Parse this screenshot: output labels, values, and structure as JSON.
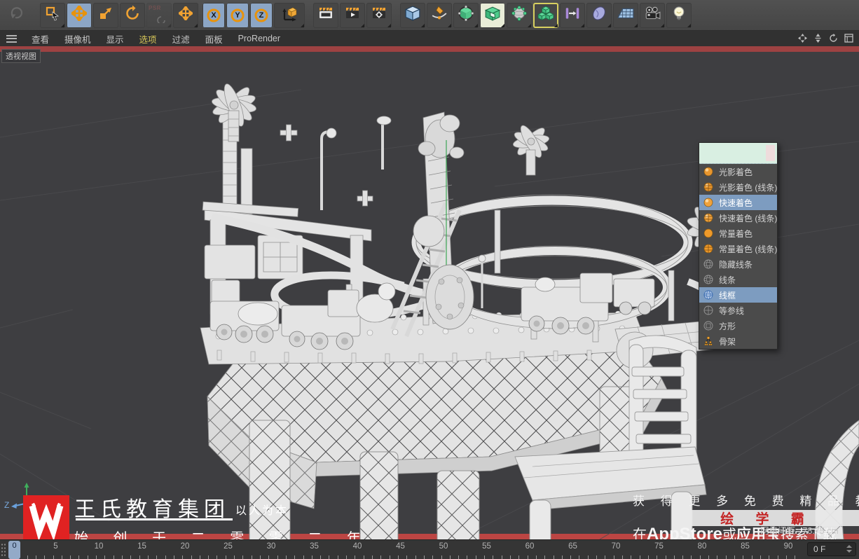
{
  "menubar": {
    "items": [
      {
        "label": "查看",
        "active": false
      },
      {
        "label": "摄像机",
        "active": false
      },
      {
        "label": "显示",
        "active": false
      },
      {
        "label": "选项",
        "active": true
      },
      {
        "label": "过滤",
        "active": false
      },
      {
        "label": "面板",
        "active": false
      },
      {
        "label": "ProRender",
        "active": false
      }
    ]
  },
  "toolbar": {
    "psr_label": "PSR",
    "axis": [
      "X",
      "Y",
      "Z"
    ]
  },
  "viewport": {
    "label": "透视视图",
    "grid_spacing": "网格间距 : 78.75 cm",
    "axis_z_label": "Z"
  },
  "shading_menu": {
    "items": [
      {
        "label": "光影着色",
        "selected": false
      },
      {
        "label": "光影着色 (线条)",
        "selected": false
      },
      {
        "label": "快速着色",
        "selected": true
      },
      {
        "label": "快速着色 (线条)",
        "selected": false
      },
      {
        "label": "常量着色",
        "selected": false
      },
      {
        "label": "常量着色 (线条)",
        "selected": false
      },
      {
        "label": "隐藏线条",
        "selected": false
      },
      {
        "label": "线条",
        "selected": false
      },
      {
        "label": "线框",
        "selected": true
      },
      {
        "label": "等参线",
        "selected": false
      },
      {
        "label": "方形",
        "selected": false
      },
      {
        "label": "骨架",
        "selected": false
      }
    ]
  },
  "watermark": {
    "brand_title": "王氏教育集团",
    "brand_slogan": "以人为本",
    "brand_line2": "始 创 于 二 零 零 二 年",
    "promo_line": "获 得 更 多 免 费 精 品 教 程",
    "badge": "绘 学 霸",
    "app_line": {
      "seg1": "在",
      "seg2": "AppStore",
      "seg3": "或",
      "seg4": "应用宝",
      "seg5": "搜索下载"
    }
  },
  "timeline": {
    "frame_labels": [
      "0",
      "5",
      "10",
      "15",
      "20",
      "25",
      "30",
      "35",
      "40",
      "45",
      "50",
      "55",
      "60",
      "65",
      "70",
      "75",
      "80",
      "85",
      "90"
    ],
    "current_frame": "0",
    "frame_field": "0 F"
  },
  "colors": {
    "accent_orange": "#f0a232",
    "tool_active_blue": "#8ca6c6",
    "menu_highlight_blue": "#7d9cc0",
    "stripe_red_top": "#9e4242",
    "stripe_red_bottom": "#bc4543",
    "logo_red": "#e02222",
    "badge_text_red": "#c42525",
    "menu_active_yellow": "#d2c257",
    "viewport_bg": "#3e3e41",
    "mint_header": "#d9efe2"
  },
  "icons": {
    "hamburger-icon": "three-lines",
    "undo-icon": "curved-arrow",
    "live-selection-icon": "square-with-cursor",
    "move-tool-icon": "four-way-arrow",
    "scale-tool-icon": "square-with-diagonal-arrow",
    "rotate-tool-icon": "circular-arrow",
    "psr-icon": "psr-with-arc",
    "axis-lock-icon": "orange-circle-letter",
    "coordinate-system-icon": "cube-with-axes",
    "render-view-icon": "clapperboard",
    "render-picture-viewer-icon": "clapperboard-play",
    "render-settings-icon": "clapperboard-gear",
    "primitive-cube-icon": "blue-cube",
    "spline-pen-icon": "pen-nib-curve",
    "subdivision-surface-icon": "green-cube-wire-circle",
    "generator-icon": "green-open-cube",
    "volume-icon": "sphere-green-dots",
    "array-icon": "three-green-cubes",
    "field-icon": "purple-bars-arrow",
    "deformer-icon": "purple-blob",
    "floor-icon": "grid-plane",
    "camera-icon": "film-camera",
    "light-icon": "light-bulb",
    "pan-view-icon": "four-triangles",
    "dolly-view-icon": "vertical-arrows",
    "rotate-view-icon": "arc-arrow",
    "toggle-view-icon": "window-panes",
    "frame-spinner-icon": "up-down-carets"
  }
}
